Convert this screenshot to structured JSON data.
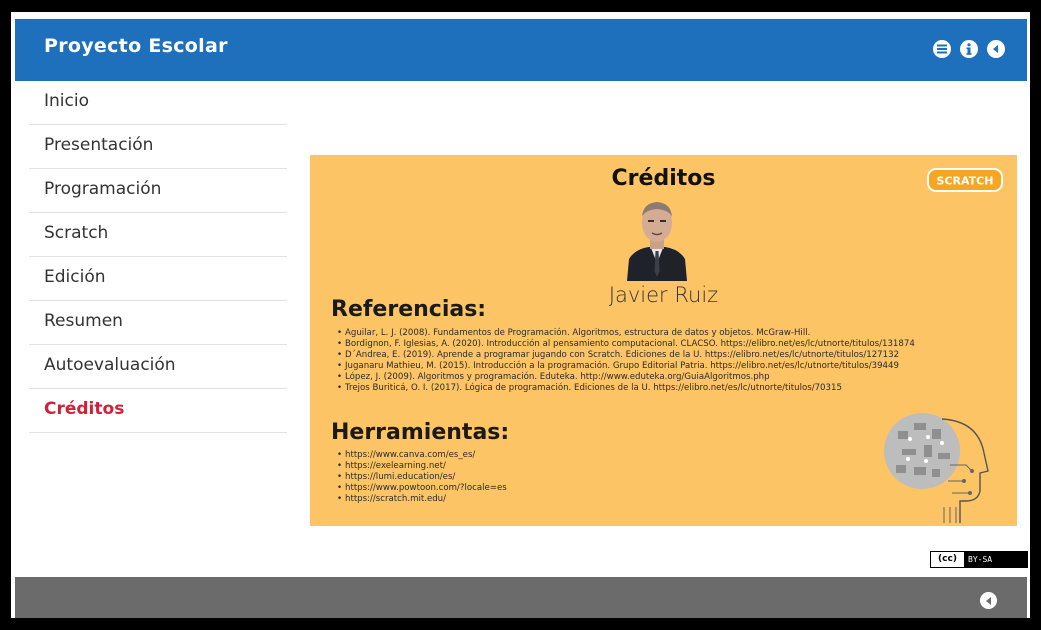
{
  "header": {
    "title": "Proyecto Escolar",
    "icons": [
      "menu-icon",
      "info-icon",
      "back-icon"
    ]
  },
  "sidebar": {
    "items": [
      {
        "label": "Inicio",
        "active": false
      },
      {
        "label": "Presentación",
        "active": false
      },
      {
        "label": "Programación",
        "active": false
      },
      {
        "label": "Scratch",
        "active": false
      },
      {
        "label": "Edición",
        "active": false
      },
      {
        "label": "Resumen",
        "active": false
      },
      {
        "label": "Autoevaluación",
        "active": false
      },
      {
        "label": "Créditos",
        "active": true
      }
    ]
  },
  "slide": {
    "title": "Créditos",
    "logo_text": "SCRATCH",
    "author": "Javier Ruiz",
    "references_heading": "Referencias:",
    "references": [
      "Aguilar, L. J. (2008). Fundamentos de Programación. Algoritmos, estructura de datos y objetos. McGraw-Hill.",
      "Bordignon, F. Iglesias, A. (2020). Introducción al pensamiento computacional. CLACSO. https://elibro.net/es/lc/utnorte/titulos/131874",
      "D´Andrea, E. (2019). Aprende a programar jugando con Scratch. Ediciones de la U. https://elibro.net/es/lc/utnorte/titulos/127132",
      "Juganaru Mathieu, M. (2015). Introducción a la programación. Grupo Editorial Patria. https://elibro.net/es/lc/utnorte/titulos/39449",
      "López, J. (2009). Algoritmos y programación. Eduteka. http://www.eduteka.org/GuiaAlgoritmos.php",
      "Trejos Buriticá, O. I. (2017). Lógica de programación. Ediciones de la U. https://elibro.net/es/lc/utnorte/titulos/70315"
    ],
    "tools_heading": "Herramientas:",
    "tools": [
      "https://www.canva.com/es_es/",
      "https://exelearning.net/",
      "https://lumi.education/es/",
      "https://www.powtoon.com/?locale=es",
      "https://scratch.mit.edu/"
    ]
  },
  "license": {
    "left": "(cc)",
    "right": "BY-SA"
  },
  "colors": {
    "header_bg": "#1e70bd",
    "active_nav": "#d21f3c",
    "slide_bg": "#fdc465",
    "footer_bg": "#6b6b6b"
  }
}
